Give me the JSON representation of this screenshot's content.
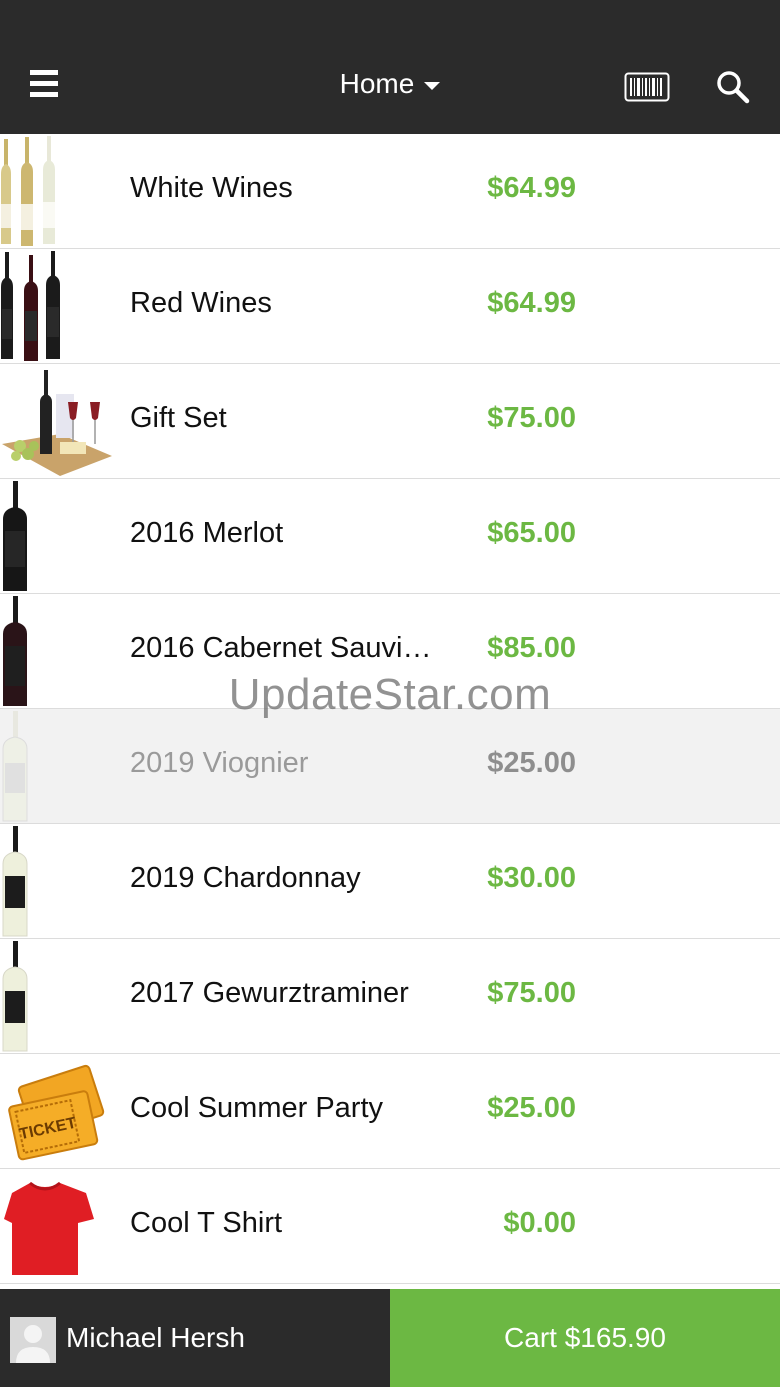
{
  "header": {
    "title": "Home",
    "menu_icon": "hamburger-menu-icon",
    "barcode_icon": "barcode-icon",
    "search_icon": "search-icon"
  },
  "products": [
    {
      "name": "White Wines",
      "price": "$64.99",
      "image": "white-wine-bottles"
    },
    {
      "name": "Red Wines",
      "price": "$64.99",
      "image": "red-wine-bottles"
    },
    {
      "name": "Gift Set",
      "price": "$75.00",
      "image": "gift-set-basket"
    },
    {
      "name": "2016 Merlot",
      "price": "$65.00",
      "image": "red-wine-bottle"
    },
    {
      "name": "2016 Cabernet Sauvi…",
      "price": "$85.00",
      "image": "red-wine-bottle"
    },
    {
      "name": "2019 Viognier",
      "price": "$25.00",
      "image": "white-wine-bottle"
    },
    {
      "name": "2019 Chardonnay",
      "price": "$30.00",
      "image": "white-wine-bottle"
    },
    {
      "name": "2017 Gewurztraminer",
      "price": "$75.00",
      "image": "white-wine-bottle"
    },
    {
      "name": "Cool Summer Party",
      "price": "$25.00",
      "image": "tickets"
    },
    {
      "name": "Cool T Shirt",
      "price": "$0.00",
      "image": "red-t-shirt"
    }
  ],
  "watermark": "UpdateStar.com",
  "footer": {
    "user_name": "Michael Hersh",
    "avatar_icon": "user-avatar-icon",
    "cart_label": "Cart $165.90"
  },
  "colors": {
    "header_bg": "#2b2b2b",
    "price_green": "#6cb843",
    "cart_green": "#6cb843"
  }
}
